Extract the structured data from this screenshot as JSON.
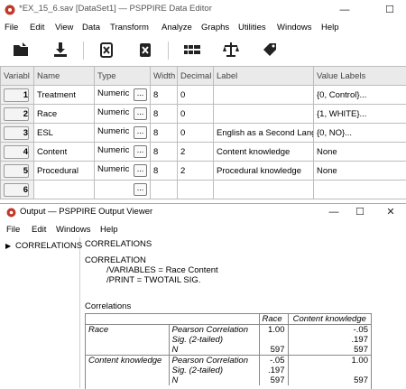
{
  "editor": {
    "title": "*EX_15_6.sav [DataSet1] — PSPPIRE Data Editor",
    "menu": [
      "File",
      "Edit",
      "View",
      "Data",
      "Transform",
      "Analyze",
      "Graphs",
      "Utilities",
      "Windows",
      "Help"
    ],
    "toolbar": [
      "open-icon",
      "save-icon",
      "goto-case-icon",
      "goto-variable-icon",
      "insert-variable-icon",
      "weight-icon",
      "value-labels-icon"
    ],
    "columns": [
      "Variabl",
      "Name",
      "Type",
      "Width",
      "Decimal",
      "Label",
      "Value Labels"
    ],
    "rows": [
      {
        "num": "1",
        "name": "Treatment",
        "type": "Numeric",
        "width": "8",
        "decimals": "0",
        "label": "",
        "values": "{0, Control}..."
      },
      {
        "num": "2",
        "name": "Race",
        "type": "Numeric",
        "width": "8",
        "decimals": "0",
        "label": "",
        "values": "{1, WHITE}..."
      },
      {
        "num": "3",
        "name": "ESL",
        "type": "Numeric",
        "width": "8",
        "decimals": "0",
        "label": "English as a Second Lang",
        "values": "{0, NO}..."
      },
      {
        "num": "4",
        "name": "Content",
        "type": "Numeric",
        "width": "8",
        "decimals": "2",
        "label": "Content knowledge",
        "values": "None"
      },
      {
        "num": "5",
        "name": "Procedural",
        "type": "Numeric",
        "width": "8",
        "decimals": "2",
        "label": "Procedural knowledge",
        "values": "None"
      },
      {
        "num": "6",
        "name": "",
        "type": "",
        "width": "",
        "decimals": "",
        "label": "",
        "values": ""
      }
    ],
    "ellipsis": "..."
  },
  "viewer": {
    "title": "Output — PSPPIRE Output Viewer",
    "menu": [
      "File",
      "Edit",
      "Windows",
      "Help"
    ],
    "nav_item": "CORRELATIONS",
    "heading": "CORRELATIONS",
    "syntax": [
      "CORRELATION",
      "/VARIABLES =  Race Content",
      "/PRINT = TWOTAIL SIG."
    ],
    "table_title": "Correlations",
    "col_headers": [
      "Race",
      "Content knowledge"
    ],
    "rows": [
      {
        "var": "Race",
        "stat": "Pearson Correlation",
        "c1": "1.00",
        "c2": "-.05"
      },
      {
        "var": "",
        "stat": "Sig. (2-tailed)",
        "c1": "",
        "c2": ".197"
      },
      {
        "var": "",
        "stat": "N",
        "c1": "597",
        "c2": "597"
      },
      {
        "var": "Content knowledge",
        "stat": "Pearson Correlation",
        "c1": "-.05",
        "c2": "1.00"
      },
      {
        "var": "",
        "stat": "Sig. (2-tailed)",
        "c1": ".197",
        "c2": ""
      },
      {
        "var": "",
        "stat": "N",
        "c1": "597",
        "c2": "597"
      }
    ]
  }
}
